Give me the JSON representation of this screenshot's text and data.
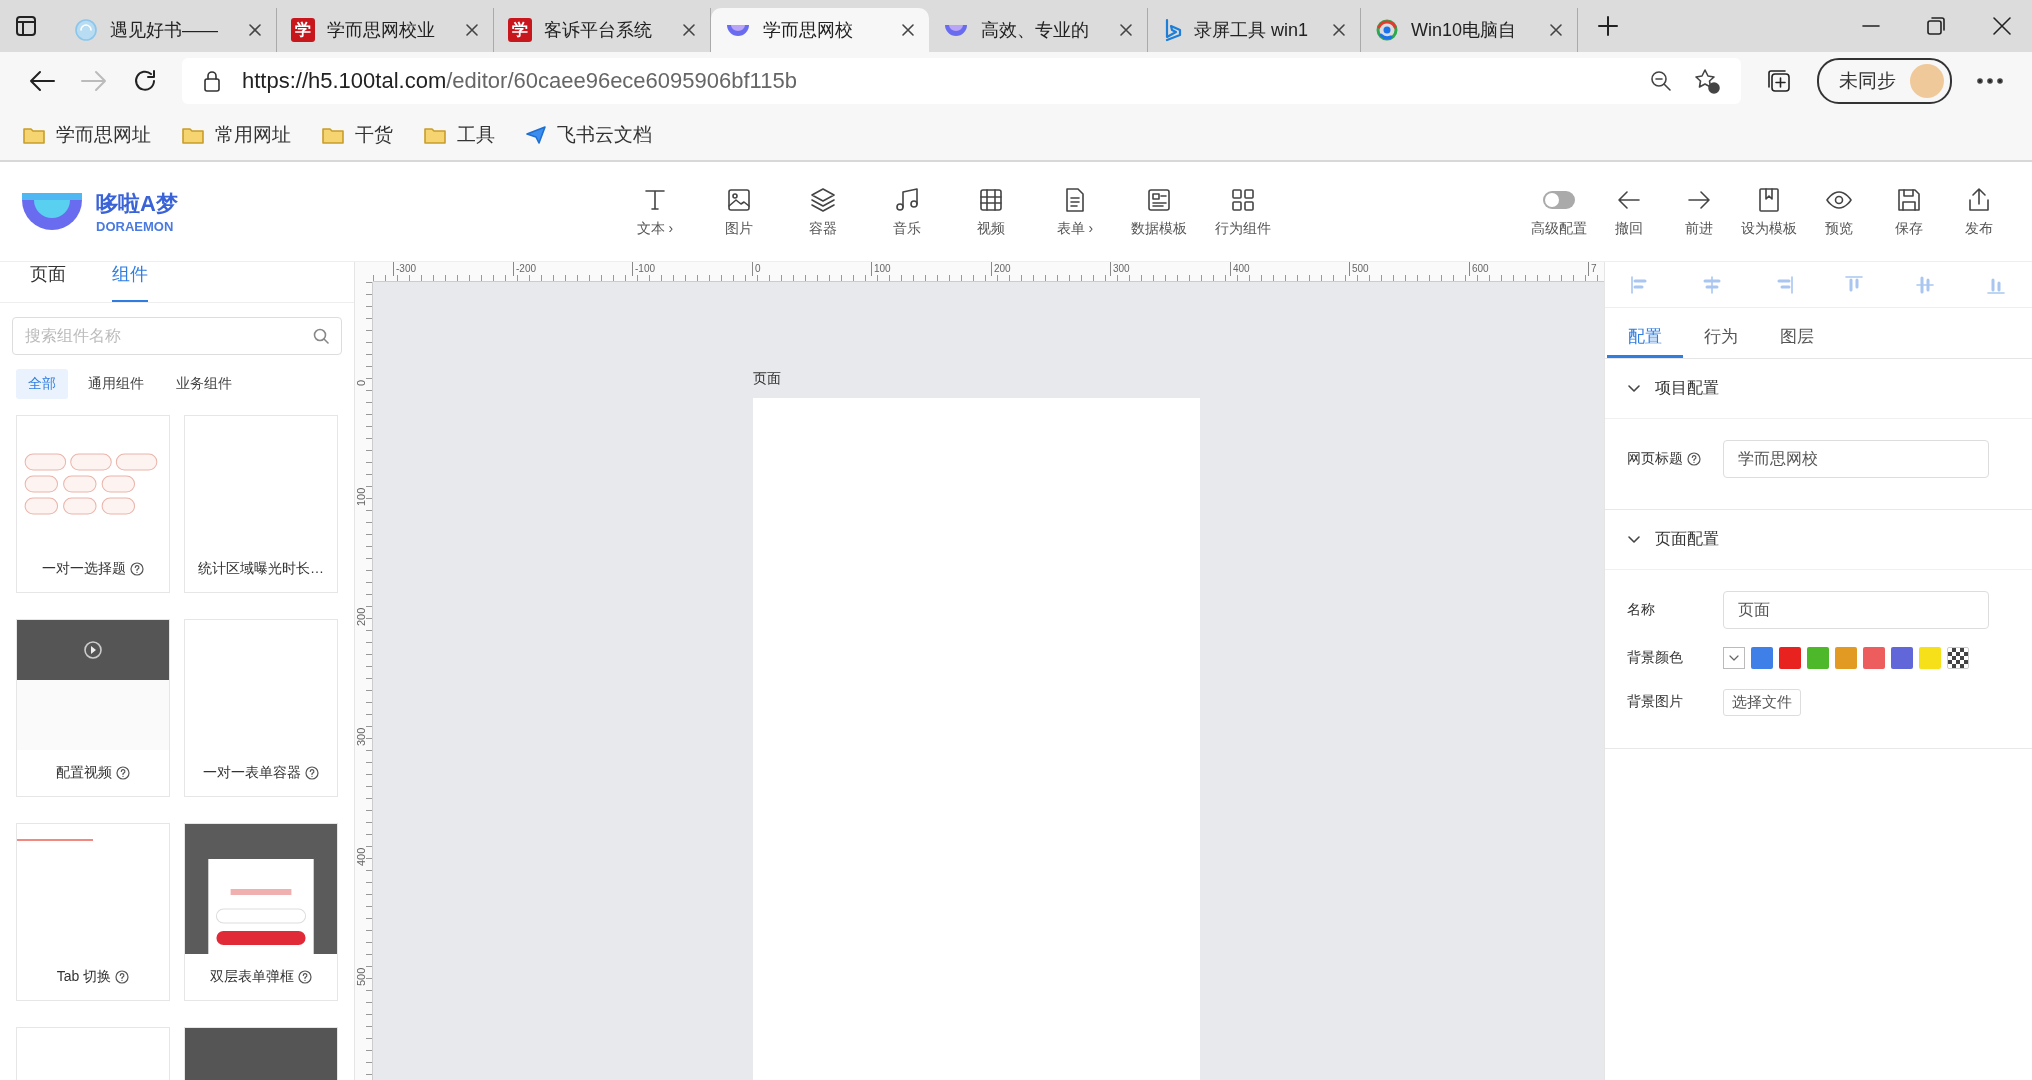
{
  "browser": {
    "tabs": [
      {
        "title": "遇见好书——",
        "kind": "swirl",
        "selected": false
      },
      {
        "title": "学而思网校业",
        "kind": "letter",
        "icon_text": "学",
        "selected": false
      },
      {
        "title": "客诉平台系统",
        "kind": "letter",
        "icon_text": "学",
        "selected": false
      },
      {
        "title": "学而思网校",
        "kind": "bowl",
        "selected": true
      },
      {
        "title": "高效、专业的",
        "kind": "bowl",
        "selected": false
      },
      {
        "title": "录屏工具 win1",
        "kind": "bing",
        "selected": false
      },
      {
        "title": "Win10电脑自",
        "kind": "ring",
        "selected": false
      }
    ],
    "url_domain": "https://h5.100tal.com",
    "url_path": "/editor/60caee96ece6095906bf115b",
    "bookmarks": [
      {
        "label": "学而思网址",
        "kind": "folder"
      },
      {
        "label": "常用网址",
        "kind": "folder"
      },
      {
        "label": "干货",
        "kind": "folder"
      },
      {
        "label": "工具",
        "kind": "folder"
      },
      {
        "label": "飞书云文档",
        "kind": "app"
      }
    ],
    "profile": "未同步"
  },
  "header": {
    "logo_name": "哆啦A梦",
    "logo_sub": "DORAEMON",
    "tools": [
      {
        "label": "文本",
        "kind": "text",
        "menu_mark": "›"
      },
      {
        "label": "图片",
        "kind": "image"
      },
      {
        "label": "容器",
        "kind": "layers"
      },
      {
        "label": "音乐",
        "kind": "music"
      },
      {
        "label": "视频",
        "kind": "grid"
      },
      {
        "label": "表单",
        "kind": "doc",
        "menu_mark": "›"
      },
      {
        "label": "数据模板",
        "kind": "card"
      },
      {
        "label": "行为组件",
        "kind": "apps"
      }
    ],
    "actions": [
      {
        "label": "高级配置",
        "kind": "toggle",
        "on": false
      },
      {
        "label": "撤回",
        "kind": "left"
      },
      {
        "label": "前进",
        "kind": "right"
      },
      {
        "label": "设为模板",
        "kind": "bookmark"
      },
      {
        "label": "预览",
        "kind": "eye"
      },
      {
        "label": "保存",
        "kind": "save"
      },
      {
        "label": "发布",
        "kind": "share"
      }
    ]
  },
  "left_panel": {
    "tabs": [
      {
        "label": "页面",
        "selected": false
      },
      {
        "label": "组件",
        "selected": true
      }
    ],
    "search": {
      "placeholder": "搜索组件名称"
    },
    "filters": [
      {
        "label": "全部",
        "selected": true
      },
      {
        "label": "通用组件",
        "selected": false
      },
      {
        "label": "业务组件",
        "selected": false
      }
    ],
    "components": [
      {
        "name": "一对一选择题",
        "help": true,
        "kind": "choices"
      },
      {
        "name": "统计区域曝光时长…",
        "help": false,
        "kind": "blank"
      },
      {
        "name": "配置视频",
        "help": true,
        "kind": "video"
      },
      {
        "name": "一对一表单容器",
        "help": true,
        "kind": "blank"
      },
      {
        "name": "Tab 切换",
        "help": true,
        "kind": "tabs"
      },
      {
        "name": "双层表单弹框",
        "help": true,
        "kind": "popup"
      },
      {
        "kind": "blank"
      },
      {
        "kind": "dark"
      }
    ]
  },
  "canvas": {
    "xticks": [
      "-300",
      "-200",
      "-100",
      "0",
      "100",
      "200",
      "300",
      "400",
      "500",
      "600",
      "7"
    ],
    "yticks": [
      "0",
      "100",
      "200",
      "300",
      "400",
      "500"
    ],
    "page_label": "页面"
  },
  "right_panel": {
    "tabs": [
      {
        "label": "配置",
        "selected": true
      },
      {
        "label": "行为",
        "selected": false
      },
      {
        "label": "图层",
        "selected": false
      }
    ],
    "sections": [
      {
        "title": "项目配置",
        "expanded": true,
        "fields": [
          {
            "label": "网页标题",
            "help": true,
            "kind": "text",
            "value": "学而思网校"
          }
        ]
      },
      {
        "title": "页面配置",
        "expanded": true,
        "fields": [
          {
            "label": "名称",
            "help": false,
            "kind": "text",
            "value": "页面"
          },
          {
            "label": "背景颜色",
            "help": false,
            "kind": "colors",
            "swatches": [
              {
                "kind": "picker"
              },
              {
                "kind": "color",
                "color": "#3e7fe8"
              },
              {
                "kind": "color",
                "color": "#e8231f"
              },
              {
                "kind": "color",
                "color": "#4cb82a"
              },
              {
                "kind": "color",
                "color": "#e39a22"
              },
              {
                "kind": "color",
                "color": "#ee5d5d"
              },
              {
                "kind": "color",
                "color": "#6166d9"
              },
              {
                "kind": "color",
                "color": "#f6e01a"
              },
              {
                "kind": "transparent"
              }
            ]
          },
          {
            "label": "背景图片",
            "help": false,
            "kind": "file",
            "button": "选择文件"
          }
        ]
      }
    ]
  }
}
